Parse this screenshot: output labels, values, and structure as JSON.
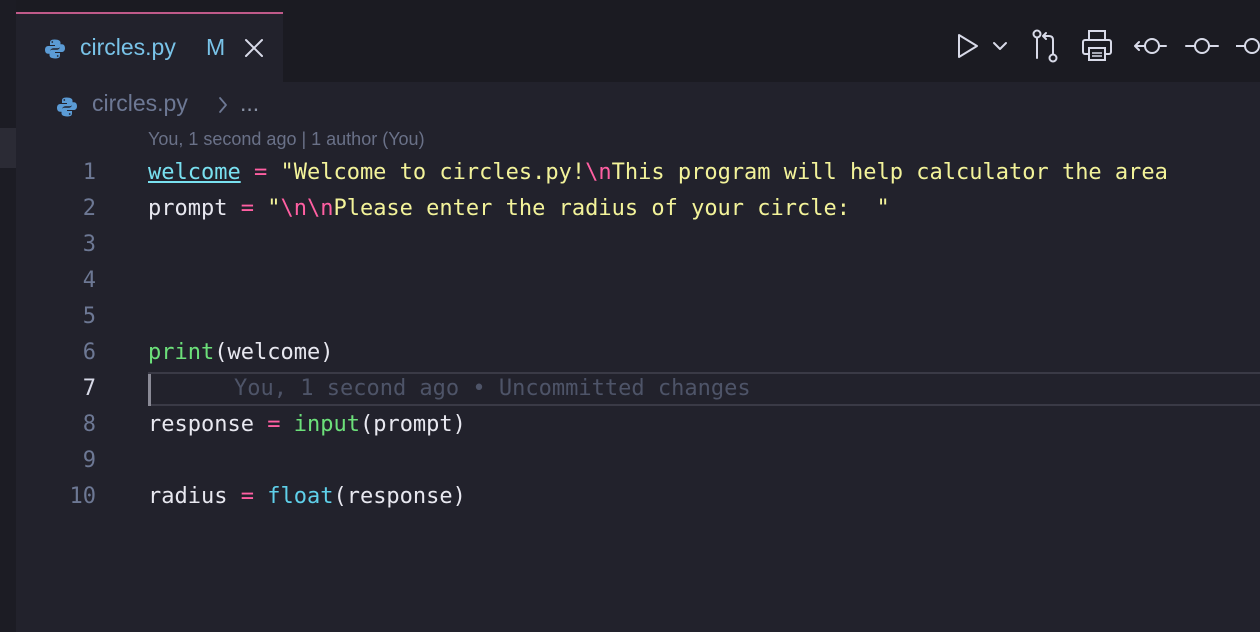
{
  "tab": {
    "file_name": "circles.py",
    "modified_badge": "M",
    "icons": {
      "file": "python-icon",
      "close": "close-icon"
    }
  },
  "toolbar": {
    "icons": [
      "run-icon",
      "chevron-down-icon",
      "compare-changes-icon",
      "print-icon",
      "previous-change-icon",
      "commit-icon",
      "next-change-icon"
    ]
  },
  "breadcrumb": {
    "file": "circles.py",
    "more": "..."
  },
  "blame": {
    "header": "You, 1 second ago | 1 author (You)",
    "inline": "You, 1 second ago • Uncommitted changes"
  },
  "editor": {
    "active_line": 7,
    "lines": [
      {
        "num": "1",
        "segments": [
          {
            "t": "welcome",
            "c": "var-ul"
          },
          {
            "t": " ",
            "c": "plain"
          },
          {
            "t": "=",
            "c": "op"
          },
          {
            "t": " ",
            "c": "plain"
          },
          {
            "t": "\"Welcome to circles.py!",
            "c": "str"
          },
          {
            "t": "\\n",
            "c": "esc"
          },
          {
            "t": "This program will help calculator the area",
            "c": "str"
          }
        ]
      },
      {
        "num": "2",
        "segments": [
          {
            "t": "prompt ",
            "c": "plain"
          },
          {
            "t": "=",
            "c": "op"
          },
          {
            "t": " ",
            "c": "plain"
          },
          {
            "t": "\"",
            "c": "str"
          },
          {
            "t": "\\n\\n",
            "c": "esc"
          },
          {
            "t": "Please enter the radius of your circle:  \"",
            "c": "str"
          }
        ]
      },
      {
        "num": "3",
        "segments": []
      },
      {
        "num": "4",
        "segments": []
      },
      {
        "num": "5",
        "segments": []
      },
      {
        "num": "6",
        "segments": [
          {
            "t": "print",
            "c": "kw-fn"
          },
          {
            "t": "(welcome)",
            "c": "plain"
          }
        ]
      },
      {
        "num": "7",
        "segments": []
      },
      {
        "num": "8",
        "segments": [
          {
            "t": "response ",
            "c": "plain"
          },
          {
            "t": "=",
            "c": "op"
          },
          {
            "t": " ",
            "c": "plain"
          },
          {
            "t": "input",
            "c": "kw-fn"
          },
          {
            "t": "(prompt)",
            "c": "plain"
          }
        ]
      },
      {
        "num": "9",
        "segments": []
      },
      {
        "num": "10",
        "segments": [
          {
            "t": "radius ",
            "c": "plain"
          },
          {
            "t": "=",
            "c": "op"
          },
          {
            "t": " ",
            "c": "plain"
          },
          {
            "t": "float",
            "c": "kw-float"
          },
          {
            "t": "(response)",
            "c": "plain"
          }
        ]
      }
    ]
  },
  "colors": {
    "background": "#22222c",
    "tab_accent": "#c05a8a",
    "string": "#f3f39a",
    "operator": "#ff5fa2",
    "function": "#6ce07a"
  }
}
